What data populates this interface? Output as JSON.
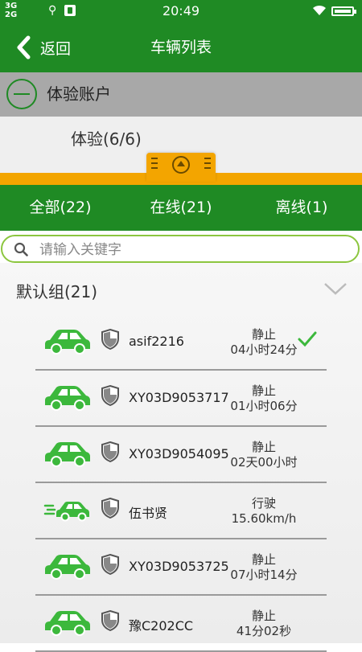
{
  "status_bar": {
    "network": [
      "3G",
      "2G"
    ],
    "time": "20:49"
  },
  "nav": {
    "back_label": "返回",
    "title": "车辆列表"
  },
  "account": {
    "label": "体验账户"
  },
  "sub_account": {
    "label": "体验(6/6)"
  },
  "tabs": [
    {
      "label": "全部(22)"
    },
    {
      "label": "在线(21)"
    },
    {
      "label": "离线(1)"
    }
  ],
  "search": {
    "placeholder": "请输入关键字"
  },
  "group": {
    "label": "默认组(21)"
  },
  "vehicles": [
    {
      "plate": "asif2216",
      "status": "静止",
      "duration": "04小时24分",
      "icon": "car-icon",
      "selected": true
    },
    {
      "plate": "XY03D9053717",
      "status": "静止",
      "duration": "01小时06分",
      "icon": "car-icon",
      "selected": false
    },
    {
      "plate": "XY03D9054095",
      "status": "静止",
      "duration": "02天00小时",
      "icon": "car-icon",
      "selected": false
    },
    {
      "plate": "伍书贤",
      "status": "行驶",
      "duration": "15.60km/h",
      "icon": "moving-car-icon",
      "selected": false
    },
    {
      "plate": "XY03D9053725",
      "status": "静止",
      "duration": "07小时14分",
      "icon": "car-icon",
      "selected": false
    },
    {
      "plate": "豫C202CC",
      "status": "静止",
      "duration": "41分02秒",
      "icon": "car-icon",
      "selected": false
    }
  ],
  "colors": {
    "primary_green": "#1f8a24",
    "accent_orange": "#f3a500",
    "car_green": "#3cb83c",
    "search_border": "#8cc63f"
  }
}
